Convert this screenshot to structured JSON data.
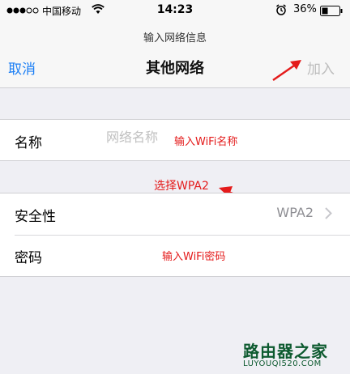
{
  "status_bar": {
    "carrier": "中国移动",
    "time": "14:23",
    "battery_pct": "36%",
    "icons": [
      "signal-icon",
      "wifi-icon",
      "alarm-icon",
      "battery-icon"
    ]
  },
  "nav": {
    "subtitle": "输入网络信息",
    "title": "其他网络",
    "cancel_label": "取消",
    "join_label": "加入"
  },
  "fields": {
    "name": {
      "label": "名称",
      "placeholder": "网络名称",
      "annotation": "输入WiFi名称"
    },
    "security": {
      "label": "安全性",
      "value": "WPA2",
      "annotation": "选择WPA2"
    },
    "password": {
      "label": "密码",
      "annotation": "输入WiFi密码"
    }
  },
  "watermark": {
    "cn": "路由器之家",
    "en": "LUYOUQI520.COM"
  },
  "colors": {
    "accent": "#1a7ef5",
    "annotation": "#e41b1b",
    "disabled": "#bdbdbd",
    "background": "#efeff4"
  }
}
